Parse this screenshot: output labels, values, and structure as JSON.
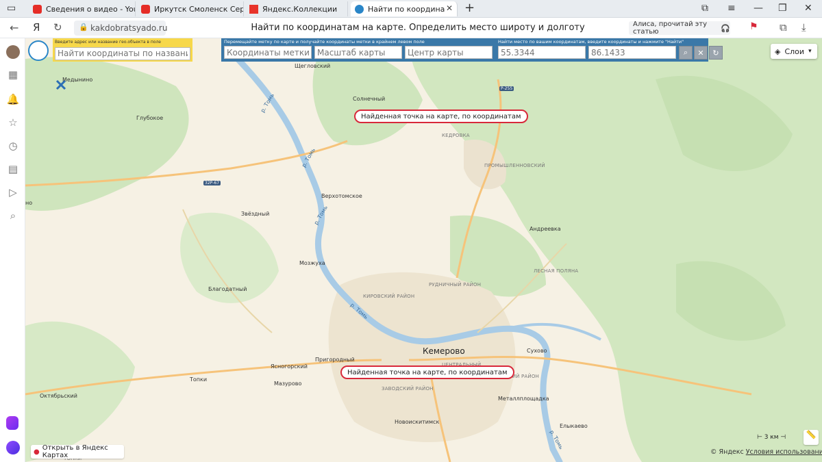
{
  "tabs": [
    {
      "label": "Сведения о видео - YouTube",
      "favicon": "youtube-icon",
      "color": "#e52d27"
    },
    {
      "label": "Иркутск Смоленск Серия 2",
      "favicon": "youtube-icon",
      "color": "#e52d27"
    },
    {
      "label": "Яндекс.Коллекции",
      "favicon": "bookmark-icon",
      "color": "#e8342b"
    },
    {
      "label": "Найти по координатам",
      "favicon": "globe-icon",
      "color": "#2a86c8"
    }
  ],
  "address_bar": {
    "url": "kakdobratsyado.ru",
    "title": "Найти по координатам на карте. Определить место широту и долготу",
    "alice_text": "Алиса, прочитай эту статью"
  },
  "search": {
    "hint": "Введите адрес или название гео.объекта в поле",
    "placeholder": "Найти координаты по названию"
  },
  "coord_panel": {
    "hint_left": "Перемещайте метку по карте и получайте координаты метки в крайнем левом поле",
    "hint_right": "Найти место по вашим координатам, введите координаты и нажмите \"Найти\"",
    "marker_coords_placeholder": "Координаты метки",
    "map_scale_placeholder": "Масштаб карты",
    "map_center_placeholder": "Центр карты",
    "latitude_placeholder": "55.3344",
    "longitude_placeholder": "86.1433"
  },
  "layers_label": "Слои",
  "callouts": [
    "Найденная точка на карте, по координатам",
    "Найденная точка на карте, по координатам"
  ],
  "map_labels": {
    "medynino": "Медынино",
    "glubokoe": "Глубокое",
    "shchegl": "Щегловский",
    "solnechny": "Солнечный",
    "kedrovka": "КЕДРОВКА",
    "promysh": "ПРОМЫШЛЕННОВСКИЙ",
    "verkhnetom": "Верхотомское",
    "zvezdny": "Звёздный",
    "andreevka": "Андреевка",
    "mozhukha": "Мозжуха",
    "blagodatny": "Благодатный",
    "rudnichny": "РУДНИЧНЫЙ РАЙОН",
    "lesnaya": "ЛЕСНАЯ ПОЛЯНА",
    "kirovsky": "КИРОВСКИЙ РАЙОН",
    "kemerovo": "Кемерово",
    "sukhovo": "Сухово",
    "prigorodny": "Пригородный",
    "yasnogorsky": "Ясногорский",
    "centralny": "ЦЕНТРАЛЬНЫЙ",
    "leninsky": "ЛЕНИНСКИЙ РАЙОН",
    "zavodsky": "ЗАВОДСКИЙ РАЙОН",
    "topki": "Топки",
    "mazurovo": "Мазурово",
    "metallploshchadka": "Металлплощадка",
    "oktyabrsky": "Октябрьский",
    "novoiskitimsk": "Новоискитимск",
    "elykaevo": "Елыкаево",
    "topki2": "ТОПКИ",
    "no": "но",
    "river_tom": "р. Томь",
    "road_r255": "Р-255",
    "road_32r67": "32Р-67"
  },
  "open_in_maps": "Открыть в Яндекс Картах",
  "scale_label": "3 км",
  "copyright": "© Яндекс",
  "terms": "Условия использования",
  "colors": {
    "forest": "#cfe5bd",
    "land": "#f6f1e4",
    "water": "#a8cbe6",
    "urban": "#ede4d0",
    "road": "#f6c37a",
    "accent": "#d8283a",
    "panel": "#3a78a8",
    "search_panel": "#f7d84a"
  }
}
